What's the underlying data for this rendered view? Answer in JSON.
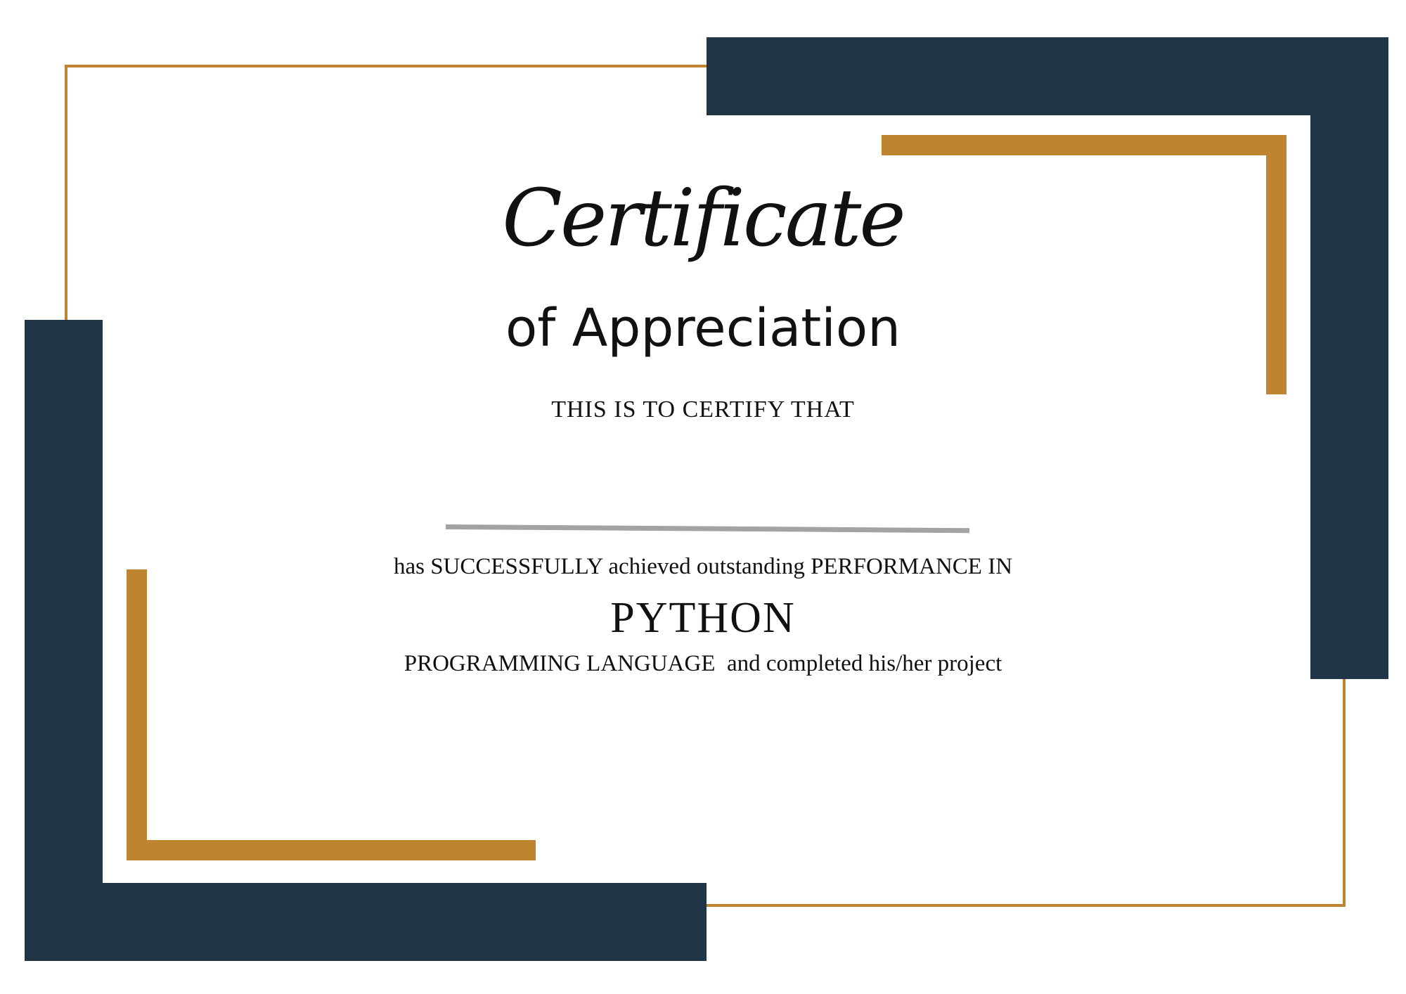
{
  "certificate": {
    "title_script": "Certificate",
    "title_sub": "of Appreciation",
    "certify_text": "THIS IS TO CERTIFY THAT",
    "body_line1": "has SUCCESSFULLY achieved outstanding PERFORMANCE IN",
    "subject": "PYTHON",
    "body_line2": "PROGRAMMING LANGUAGE  and completed his/her project"
  },
  "colors": {
    "navy": "#203646",
    "gold": "#BF8430",
    "line_gray": "#a3a3a3",
    "text": "#111111"
  }
}
